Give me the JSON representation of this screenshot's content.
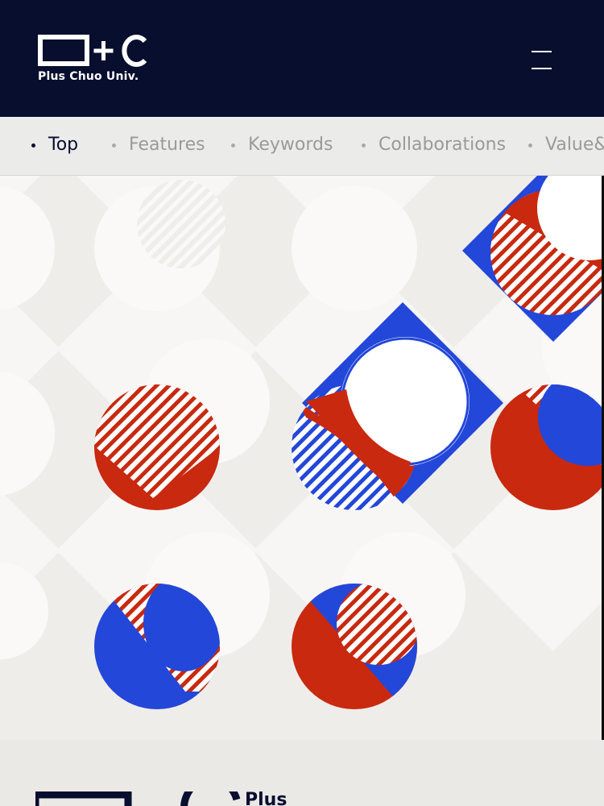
{
  "header": {
    "logo_mark": "□+C",
    "logo_text": "Plus Chuo Univ.",
    "menu_icon": "hamburger-menu-icon",
    "background_color": "#070e2e"
  },
  "nav": {
    "items": [
      {
        "label": "Top",
        "active": true
      },
      {
        "label": "Features",
        "active": false
      },
      {
        "label": "Keywords",
        "active": false
      },
      {
        "label": "Collaborations",
        "active": false
      },
      {
        "label": "Value&",
        "active": false
      }
    ]
  },
  "hero": {
    "pattern_colors": {
      "blue": "#2347d9",
      "red": "#c8290f",
      "white": "#f7f6f4",
      "background": "#efedea"
    }
  },
  "footer": {
    "logo_text": "Plus"
  }
}
